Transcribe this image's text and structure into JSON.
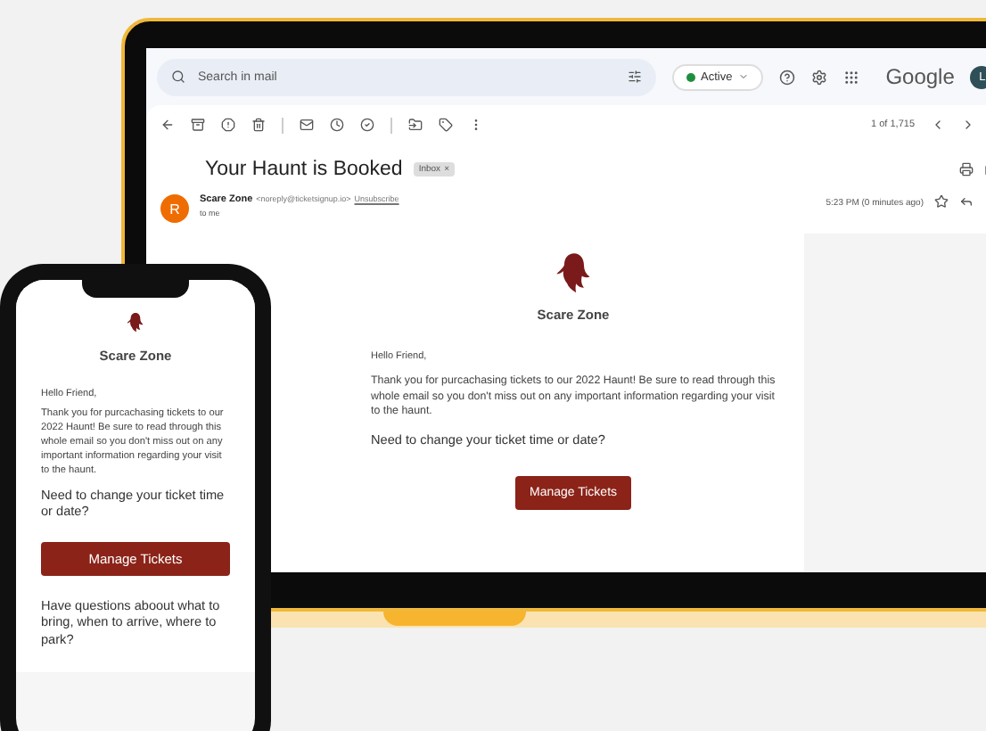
{
  "gmail": {
    "search": {
      "placeholder": "Search in mail"
    },
    "status": "Active",
    "brand": "Google",
    "avatar": "L",
    "pager": "1 of 1,715",
    "subject": "Your Haunt is Booked",
    "label_chip": {
      "text": "Inbox",
      "close": "×"
    },
    "sender": {
      "avatar": "R",
      "name": "Scare Zone",
      "address": "<noreply@ticketsignup.io>",
      "unsubscribe": "Unsubscribe",
      "to": "to me",
      "time": "5:23 PM (0 minutes ago)"
    }
  },
  "laptop_email": {
    "brand": "Scare Zone",
    "greeting": "Hello Friend,",
    "body": "Thank you for purcachasing tickets to our 2022 Haunt! Be sure to read through this whole email so you don't miss out on any important information regarding your visit to the haunt.",
    "question": "Need to change your ticket time or date?",
    "button": "Manage Tickets"
  },
  "phone_email": {
    "brand": "Scare Zone",
    "greeting": "Hello Friend,",
    "body": "Thank you for purcachasing tickets to our 2022 Haunt! Be sure to read through this whole email so you don't miss out on any important information regarding your visit to the haunt.",
    "question": "Need to change your ticket time or date?",
    "button": "Manage Tickets",
    "question_2": "Have questions aboout what to bring, when to arrive, where to park?"
  }
}
